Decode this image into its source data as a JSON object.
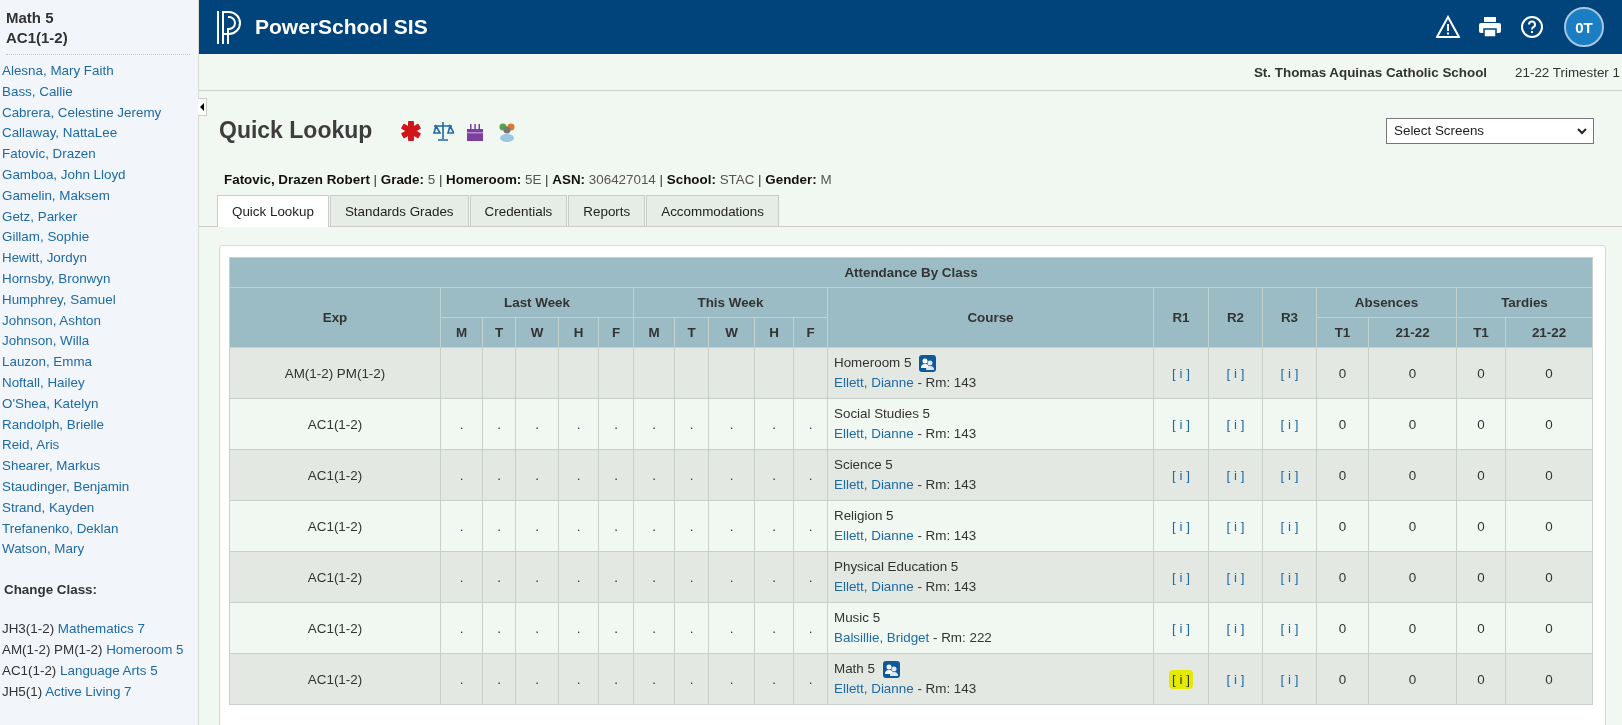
{
  "sidebar": {
    "class_name": "Math 5",
    "class_code": "AC1(1-2)",
    "students": [
      "Alesna, Mary Faith",
      "Bass, Callie",
      "Cabrera, Celestine Jeremy",
      "Callaway, NattaLee",
      "Fatovic, Drazen",
      "Gamboa, John Lloyd",
      "Gamelin, Maksem",
      "Getz, Parker",
      "Gillam, Sophie",
      "Hewitt, Jordyn",
      "Hornsby, Bronwyn",
      "Humphrey, Samuel",
      "Johnson, Ashton",
      "Johnson, Willa",
      "Lauzon, Emma",
      "Noftall, Hailey",
      "O'Shea, Katelyn",
      "Randolph, Brielle",
      "Reid, Aris",
      "Shearer, Markus",
      "Staudinger, Benjamin",
      "Strand, Kayden",
      "Trefanenko, Deklan",
      "Watson, Mary"
    ],
    "change_class_heading": "Change Class:",
    "classes": [
      {
        "code": "JH3(1-2)",
        "name": "Mathematics 7"
      },
      {
        "code": "AM(1-2) PM(1-2)",
        "name": "Homeroom 5"
      },
      {
        "code": "AC1(1-2)",
        "name": "Language Arts 5"
      },
      {
        "code": "JH5(1)",
        "name": "Active Living 7"
      }
    ]
  },
  "header": {
    "brand": "PowerSchool SIS",
    "avatar": "0T"
  },
  "school_bar": {
    "school": "St. Thomas Aquinas Catholic School",
    "term": "21-22 Trimester 1"
  },
  "page": {
    "title": "Quick Lookup",
    "screens_select": {
      "value": "Select Screens"
    }
  },
  "student_info": {
    "name": "Fatovic, Drazen Robert",
    "separator": "|",
    "fields": [
      {
        "label": "Grade:",
        "value": "5"
      },
      {
        "label": "Homeroom:",
        "value": "5E"
      },
      {
        "label": "ASN:",
        "value": "306427014"
      },
      {
        "label": "School:",
        "value": "STAC"
      },
      {
        "label": "Gender:",
        "value": "M"
      }
    ]
  },
  "tabs": [
    {
      "label": "Quick Lookup",
      "selected": true
    },
    {
      "label": "Standards Grades",
      "selected": false
    },
    {
      "label": "Credentials",
      "selected": false
    },
    {
      "label": "Reports",
      "selected": false
    },
    {
      "label": "Accommodations",
      "selected": false
    }
  ],
  "table": {
    "title": "Attendance By Class",
    "exp_header": "Exp",
    "last_week": "Last Week",
    "this_week": "This Week",
    "days": [
      "M",
      "T",
      "W",
      "H",
      "F",
      "M",
      "T",
      "W",
      "H",
      "F"
    ],
    "course_header": "Course",
    "r_headers": [
      "R1",
      "R2",
      "R3"
    ],
    "absences": "Absences",
    "tardies": "Tardies",
    "sub_headers": [
      "T1",
      "21-22",
      "T1",
      "21-22"
    ],
    "rows": [
      {
        "exp": "AM(1-2) PM(1-2)",
        "course": "Homeroom 5",
        "group_icon": true,
        "teacher": "Ellett, Dianne",
        "room": "- Rm: 143",
        "r": [
          {
            "text": "[ i ]",
            "highlighted": false
          },
          {
            "text": "[ i ]",
            "highlighted": false
          },
          {
            "text": "[ i ]",
            "highlighted": false
          }
        ],
        "counts": [
          "0",
          "0",
          "0",
          "0"
        ]
      },
      {
        "exp": "AC1(1-2)",
        "days": [
          ".",
          ".",
          ".",
          ".",
          ".",
          ".",
          ".",
          ".",
          ".",
          "."
        ],
        "course": "Social Studies 5",
        "group_icon": false,
        "teacher": "Ellett, Dianne",
        "room": "- Rm: 143",
        "r": [
          {
            "text": "[ i ]",
            "highlighted": false
          },
          {
            "text": "[ i ]",
            "highlighted": false
          },
          {
            "text": "[ i ]",
            "highlighted": false
          }
        ],
        "counts": [
          "0",
          "0",
          "0",
          "0"
        ]
      },
      {
        "exp": "AC1(1-2)",
        "days": [
          ".",
          ".",
          ".",
          ".",
          ".",
          ".",
          ".",
          ".",
          ".",
          "."
        ],
        "course": "Science 5",
        "group_icon": false,
        "teacher": "Ellett, Dianne",
        "room": "- Rm: 143",
        "r": [
          {
            "text": "[ i ]",
            "highlighted": false
          },
          {
            "text": "[ i ]",
            "highlighted": false
          },
          {
            "text": "[ i ]",
            "highlighted": false
          }
        ],
        "counts": [
          "0",
          "0",
          "0",
          "0"
        ]
      },
      {
        "exp": "AC1(1-2)",
        "days": [
          ".",
          ".",
          ".",
          ".",
          ".",
          ".",
          ".",
          ".",
          ".",
          "."
        ],
        "course": "Religion 5",
        "group_icon": false,
        "teacher": "Ellett, Dianne",
        "room": "- Rm: 143",
        "r": [
          {
            "text": "[ i ]",
            "highlighted": false
          },
          {
            "text": "[ i ]",
            "highlighted": false
          },
          {
            "text": "[ i ]",
            "highlighted": false
          }
        ],
        "counts": [
          "0",
          "0",
          "0",
          "0"
        ]
      },
      {
        "exp": "AC1(1-2)",
        "days": [
          ".",
          ".",
          ".",
          ".",
          ".",
          ".",
          ".",
          ".",
          ".",
          "."
        ],
        "course": "Physical Education 5",
        "group_icon": false,
        "teacher": "Ellett, Dianne",
        "room": "- Rm: 143",
        "r": [
          {
            "text": "[ i ]",
            "highlighted": false
          },
          {
            "text": "[ i ]",
            "highlighted": false
          },
          {
            "text": "[ i ]",
            "highlighted": false
          }
        ],
        "counts": [
          "0",
          "0",
          "0",
          "0"
        ]
      },
      {
        "exp": "AC1(1-2)",
        "days": [
          ".",
          ".",
          ".",
          ".",
          ".",
          ".",
          ".",
          ".",
          ".",
          "."
        ],
        "course": "Music 5",
        "group_icon": false,
        "teacher": "Balsillie, Bridget",
        "room": "- Rm: 222",
        "r": [
          {
            "text": "[ i ]",
            "highlighted": false
          },
          {
            "text": "[ i ]",
            "highlighted": false
          },
          {
            "text": "[ i ]",
            "highlighted": false
          }
        ],
        "counts": [
          "0",
          "0",
          "0",
          "0"
        ]
      },
      {
        "exp": "AC1(1-2)",
        "days": [
          ".",
          ".",
          ".",
          ".",
          ".",
          ".",
          ".",
          ".",
          ".",
          "."
        ],
        "course": "Math 5",
        "group_icon": true,
        "teacher": "Ellett, Dianne",
        "room": "- Rm: 143",
        "r": [
          {
            "text": "[ i ]",
            "highlighted": true
          },
          {
            "text": "[ i ]",
            "highlighted": false
          },
          {
            "text": "[ i ]",
            "highlighted": false
          }
        ],
        "counts": [
          "0",
          "0",
          "0",
          "0"
        ]
      }
    ]
  }
}
